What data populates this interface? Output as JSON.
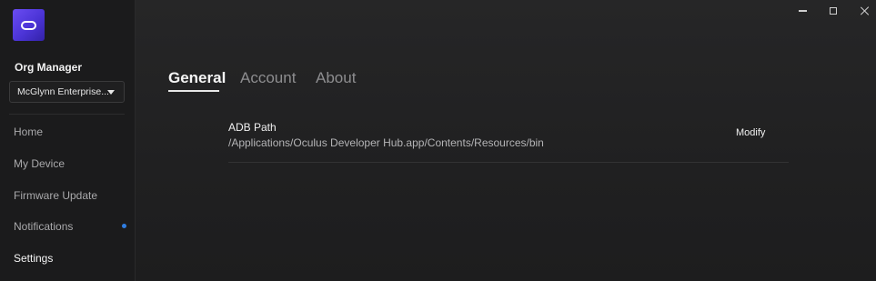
{
  "sidebar": {
    "org_title": "Org Manager",
    "org_select_value": "McGlynn Enterprise...",
    "items": [
      {
        "label": "Home"
      },
      {
        "label": "My Device"
      },
      {
        "label": "Firmware Update"
      },
      {
        "label": "Notifications"
      },
      {
        "label": "Settings"
      }
    ]
  },
  "tabs": [
    {
      "label": "General"
    },
    {
      "label": "Account"
    },
    {
      "label": "About"
    }
  ],
  "settings": {
    "adb_label": "ADB Path",
    "adb_value": "/Applications/Oculus Developer Hub.app/Contents/Resources/bin",
    "modify_label": "Modify"
  },
  "colors": {
    "logo_accent": "#5a40e6",
    "notification_dot": "#2f7de1"
  }
}
